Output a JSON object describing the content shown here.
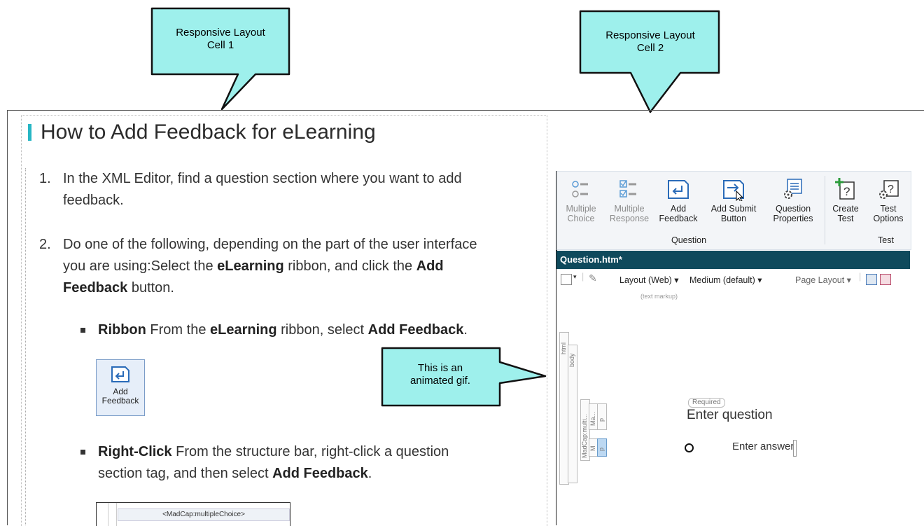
{
  "callouts": {
    "cell1": {
      "line1": "Responsive Layout",
      "line2": "Cell 1"
    },
    "cell2": {
      "line1": "Responsive Layout",
      "line2": "Cell 2"
    },
    "gif": {
      "line1": "This is an",
      "line2": "animated gif."
    }
  },
  "colors": {
    "callout_fill": "#9ef0ec",
    "accent": "#27b6c4",
    "tab_bg": "#0f4a5c"
  },
  "doc": {
    "heading": "How to Add Feedback for eLearning",
    "step1": {
      "num": "1.",
      "line1": "In the XML Editor, find a question section where you want to add",
      "line2": "feedback."
    },
    "step2": {
      "num": "2.",
      "line1": "Do one of the following, depending on the part of the user interface",
      "line2a": "you are using:Select the ",
      "line2b": "eLearning",
      "line2c": " ribbon, and click the ",
      "line2d": "Add",
      "line3a": "Feedback",
      "line3b": " button."
    },
    "bullet1": {
      "a": "Ribbon",
      "b": " From the ",
      "c": "eLearning",
      "d": " ribbon, select ",
      "e": "Add Feedback",
      "f": "."
    },
    "img_add_feedback": {
      "line1": "Add",
      "line2": "Feedback"
    },
    "bullet2": {
      "a": "Right-Click",
      "b": " From the structure bar, right-click a question",
      "c": "section tag, and then select ",
      "d": "Add Feedback",
      "e": "."
    },
    "img_struct": "<MadCap:multipleChoice>"
  },
  "ribbon": {
    "buttons": [
      {
        "l1": "Multiple",
        "l2": "Choice",
        "icon": "multiple-choice-icon",
        "disabled": true
      },
      {
        "l1": "Multiple",
        "l2": "Response",
        "icon": "multiple-response-icon",
        "disabled": true
      },
      {
        "l1": "Add",
        "l2": "Feedback",
        "icon": "add-feedback-icon",
        "disabled": false
      },
      {
        "l1": "Add Submit",
        "l2": "Button",
        "icon": "add-submit-button-icon",
        "disabled": false
      },
      {
        "l1": "Question",
        "l2": "Properties",
        "icon": "question-properties-icon",
        "disabled": false
      },
      {
        "l1": "Create",
        "l2": "Test",
        "icon": "create-test-icon",
        "disabled": false
      },
      {
        "l1": "Test",
        "l2": "Options",
        "icon": "test-options-icon",
        "disabled": false
      }
    ],
    "group_question": "Question",
    "group_test": "Test"
  },
  "editor": {
    "tab": "Question.htm*",
    "layout": "Layout (Web)",
    "medium": "Medium (default)",
    "page_layout": "Page Layout",
    "text_markup": "(text markup)",
    "required": "Required",
    "question": "Enter question",
    "answer": "Enter answer",
    "struct_html": "html",
    "struct_body": "body",
    "struct_madcap": "MadCap:multi...",
    "struct_ma": "Ma...",
    "struct_p1": "p",
    "struct_m": "M",
    "struct_p2": "p"
  }
}
